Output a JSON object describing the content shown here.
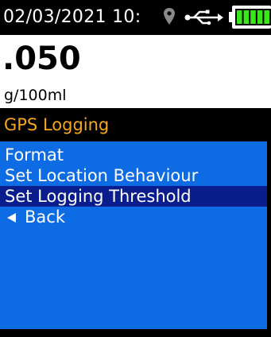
{
  "status_bar": {
    "datetime": "02/03/2021 10:",
    "location_icon": "location-pin-icon",
    "usb_icon": "usb-icon",
    "battery_icon": "battery-full-icon",
    "battery_color": "#39e51b",
    "battery_level": 1.0
  },
  "reading": {
    "value": ".050",
    "unit": "g/100ml"
  },
  "menu": {
    "title": "GPS Logging",
    "title_color": "#f7a71b",
    "background_color": "#0d6be4",
    "selected_color": "#0a1d8c",
    "items": [
      {
        "label": "Format"
      },
      {
        "label": "Set Location Behaviour"
      },
      {
        "label": "Set Logging Threshold",
        "selected": true
      },
      {
        "label": "Back",
        "icon": "back-arrow-icon"
      }
    ]
  }
}
